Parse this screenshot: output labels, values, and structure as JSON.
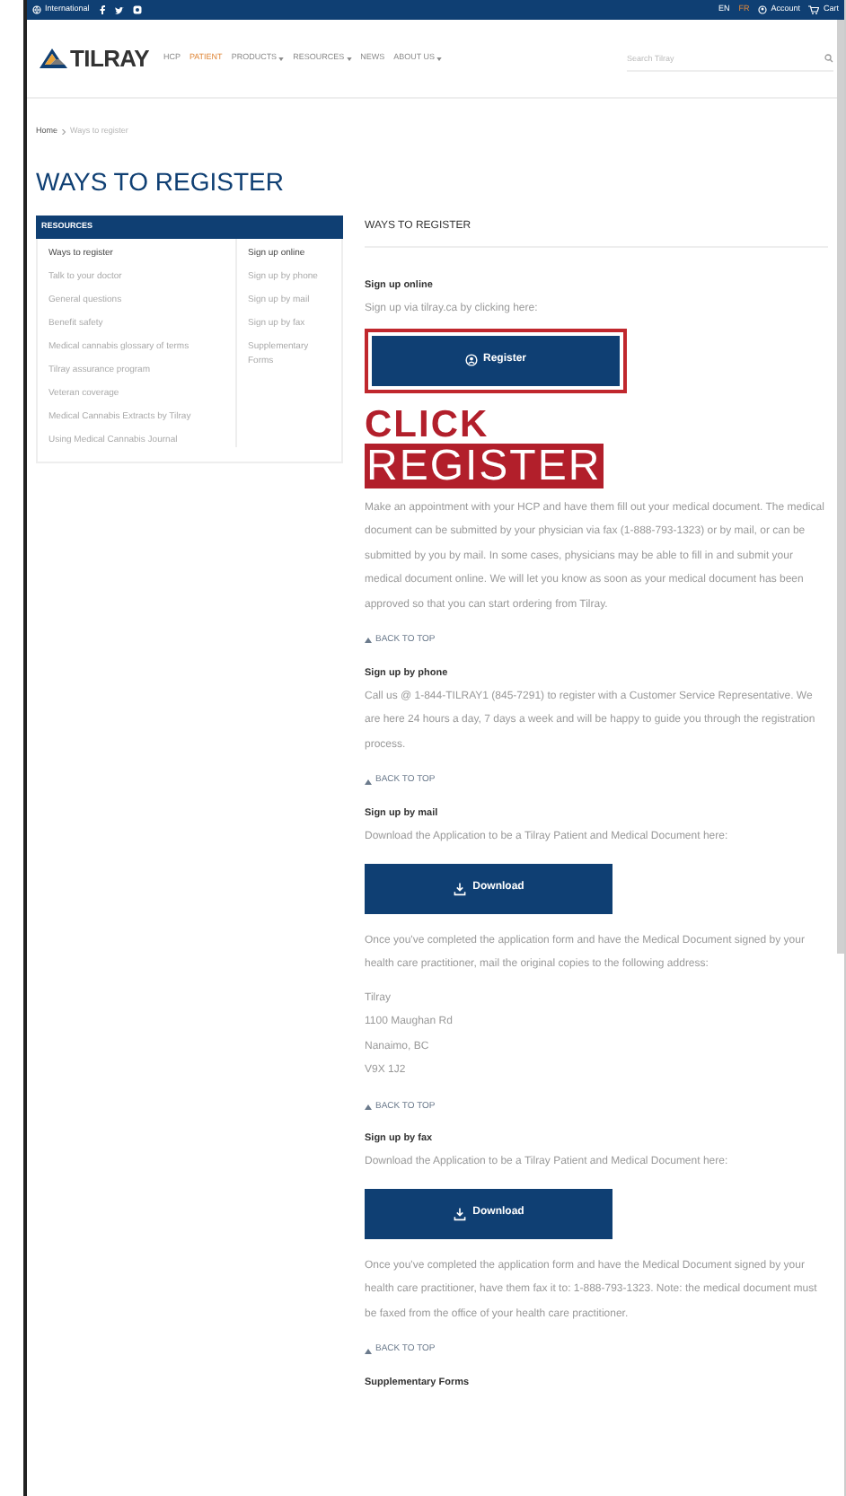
{
  "top_bar": {
    "region": "International",
    "languages": [
      {
        "label": "EN",
        "selected": true
      },
      {
        "label": "FR",
        "selected": false
      }
    ],
    "account": "Account",
    "cart": "Cart"
  },
  "nav": {
    "logo": "TILRAY",
    "items": [
      {
        "label": "HCP",
        "selected": false,
        "dropdown": false
      },
      {
        "label": "PATIENT",
        "selected": true,
        "dropdown": false
      },
      {
        "label": "PRODUCTS",
        "selected": false,
        "dropdown": true
      },
      {
        "label": "RESOURCES",
        "selected": false,
        "dropdown": true
      },
      {
        "label": "NEWS",
        "selected": false,
        "dropdown": false
      },
      {
        "label": "ABOUT US",
        "selected": false,
        "dropdown": true
      }
    ],
    "search": {
      "placeholder": "Search Tilray"
    }
  },
  "breadcrumb": [
    {
      "label": "Home",
      "current": false
    },
    {
      "label": "Ways to register",
      "current": true
    }
  ],
  "page_title": "WAYS TO REGISTER",
  "sidebar": {
    "title": "RESOURCES",
    "columns": [
      [
        {
          "label": "Ways to register",
          "selected": true
        },
        {
          "label": "Talk to your doctor",
          "selected": false
        },
        {
          "label": "General questions",
          "selected": false
        },
        {
          "label": "Benefit safety",
          "selected": false
        },
        {
          "label": "Medical cannabis glossary of terms",
          "selected": false
        },
        {
          "label": "Tilray assurance program",
          "selected": false
        },
        {
          "label": "Veteran coverage",
          "selected": false
        },
        {
          "label": "Medical Cannabis Extracts by Tilray",
          "selected": false
        },
        {
          "label": "Using Medical Cannabis Journal",
          "selected": false
        }
      ],
      [
        {
          "label": "Sign up online",
          "selected": true
        },
        {
          "label": "Sign up by phone",
          "selected": false
        },
        {
          "label": "Sign up by mail",
          "selected": false
        },
        {
          "label": "Sign up by fax",
          "selected": false
        },
        {
          "label": "Supplementary Forms",
          "selected": false
        }
      ]
    ]
  },
  "content": {
    "heading": "WAYS TO REGISTER",
    "sections": [
      {
        "title": "Sign up online",
        "blocks": [
          {
            "kind": "text",
            "text": "Sign up via tilray.ca by clicking here:"
          },
          {
            "kind": "button",
            "label": "Register",
            "highlighted": true
          },
          {
            "kind": "callout",
            "lines": [
              "CLICK",
              "REGISTER"
            ]
          },
          {
            "kind": "text",
            "text": "Make an appointment with your HCP and have them fill out your medical document. The medical document can be submitted by your physician via fax (1-888-793-1323) or by mail, or can be submitted by you by mail. In some cases, physicians may be able to fill in and submit your medical document online. We will let you know as soon as your medical document has been approved so that you can start ordering from Tilray."
          },
          {
            "kind": "back_to_top",
            "label": "BACK TO TOP"
          }
        ]
      },
      {
        "title": "Sign up by phone",
        "blocks": [
          {
            "kind": "text",
            "text": "Call us @ 1-844-TILRAY1 (845-7291) to register with a Customer Service Representative. We are here 24 hours a day, 7 days a week and will be happy to guide you through the registration process."
          },
          {
            "kind": "back_to_top",
            "label": "BACK TO TOP"
          }
        ]
      },
      {
        "title": "Sign up by mail",
        "blocks": [
          {
            "kind": "text",
            "text": "Download the Application to be a Tilray Patient and Medical Document here:"
          },
          {
            "kind": "download",
            "label": "Download"
          },
          {
            "kind": "text",
            "text": "Once you've completed the application form and have the Medical Document signed by your health care practitioner, mail the original copies to the following address:"
          },
          {
            "kind": "address",
            "lines": [
              "Tilray",
              "1100 Maughan Rd",
              "Nanaimo, BC",
              "V9X 1J2"
            ]
          },
          {
            "kind": "back_to_top",
            "label": "BACK TO TOP"
          }
        ]
      },
      {
        "title": "Sign up by fax",
        "blocks": [
          {
            "kind": "text",
            "text": "Download the Application to be a Tilray Patient and Medical Document here:"
          },
          {
            "kind": "download",
            "label": "Download"
          },
          {
            "kind": "text",
            "text": "Once you've completed the application form and have the Medical Document signed by your health care practitioner, have them fax it to: 1-888-793-1323. Note: the medical document must be faxed from the office of your health care practitioner."
          },
          {
            "kind": "back_to_top",
            "label": "BACK TO TOP"
          }
        ]
      },
      {
        "title": "Supplementary Forms"
      }
    ]
  }
}
